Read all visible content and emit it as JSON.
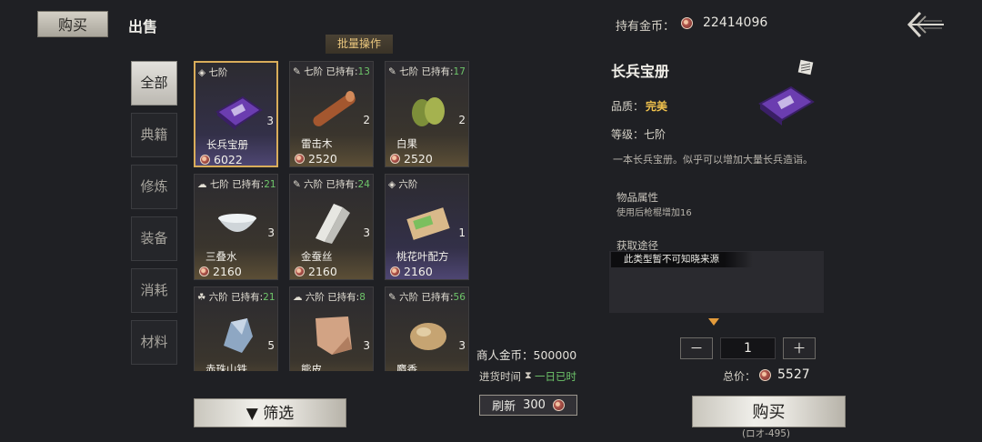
{
  "tabs": {
    "buy": "购买",
    "sell": "出售"
  },
  "gold": {
    "label": "持有金币：",
    "value": "22414096"
  },
  "batch_label": "批量操作",
  "categories": [
    "全部",
    "典籍",
    "修炼",
    "装备",
    "消耗",
    "材料"
  ],
  "items": [
    {
      "grade": "七阶",
      "owned_label": "",
      "owned": "",
      "qty": "3",
      "name": "长兵宝册",
      "price": "6022",
      "icon": "book-icon",
      "tone": "purple"
    },
    {
      "grade": "七阶",
      "owned_label": "已持有:",
      "owned": "13",
      "qty": "2",
      "name": "雷击木",
      "price": "2520",
      "icon": "wood-icon",
      "tone": "gold"
    },
    {
      "grade": "七阶",
      "owned_label": "已持有:",
      "owned": "17",
      "qty": "2",
      "name": "白果",
      "price": "2520",
      "icon": "ginkgo-icon",
      "tone": "gold"
    },
    {
      "grade": "七阶",
      "owned_label": "已持有:",
      "owned": "21",
      "qty": "3",
      "name": "三叠水",
      "price": "2160",
      "icon": "bowl-icon",
      "tone": "gold"
    },
    {
      "grade": "六阶",
      "owned_label": "已持有:",
      "owned": "24",
      "qty": "3",
      "name": "金蚕丝",
      "price": "2160",
      "icon": "silk-icon",
      "tone": "gold"
    },
    {
      "grade": "六阶",
      "owned_label": "",
      "owned": "",
      "qty": "1",
      "name": "桃花叶配方",
      "price": "2160",
      "icon": "scroll-icon",
      "tone": "purple"
    },
    {
      "grade": "六阶",
      "owned_label": "已持有:",
      "owned": "21",
      "qty": "5",
      "name": "赤珠山铁",
      "price": "",
      "icon": "ore-icon",
      "tone": "gold"
    },
    {
      "grade": "六阶",
      "owned_label": "已持有:",
      "owned": "8",
      "qty": "3",
      "name": "熊皮",
      "price": "",
      "icon": "hide-icon",
      "tone": "gold"
    },
    {
      "grade": "六阶",
      "owned_label": "已持有:",
      "owned": "56",
      "qty": "3",
      "name": "麝香",
      "price": "",
      "icon": "musk-icon",
      "tone": "gold"
    }
  ],
  "filter_label": "筛选",
  "merchant": {
    "label": "商人金币：",
    "value": "500000"
  },
  "restock": {
    "label": "进货时间",
    "value": "一日已时"
  },
  "refresh": {
    "label": "刷新",
    "cost": "300"
  },
  "detail": {
    "title": "长兵宝册",
    "quality_label": "品质：",
    "quality_value": "完美",
    "level": "等级：七阶",
    "description": "一本长兵宝册。似乎可以增加大量长兵造诣。",
    "attr_header": "物品属性",
    "attr_value": "使用后枪棍增加16",
    "source_header": "获取途径",
    "source_value": "此类型暂不可知晓来源"
  },
  "purchase": {
    "minus": "－",
    "plus": "＋",
    "quantity": "1",
    "total_label": "总价：",
    "total_value": "5527",
    "buy_label": "购买",
    "buy_hint": "(ロオ-495)"
  },
  "colors": {
    "selected_border": "#d9ad5a",
    "owned_green": "#6ec56a",
    "quality_gold": "#f0c24d"
  }
}
